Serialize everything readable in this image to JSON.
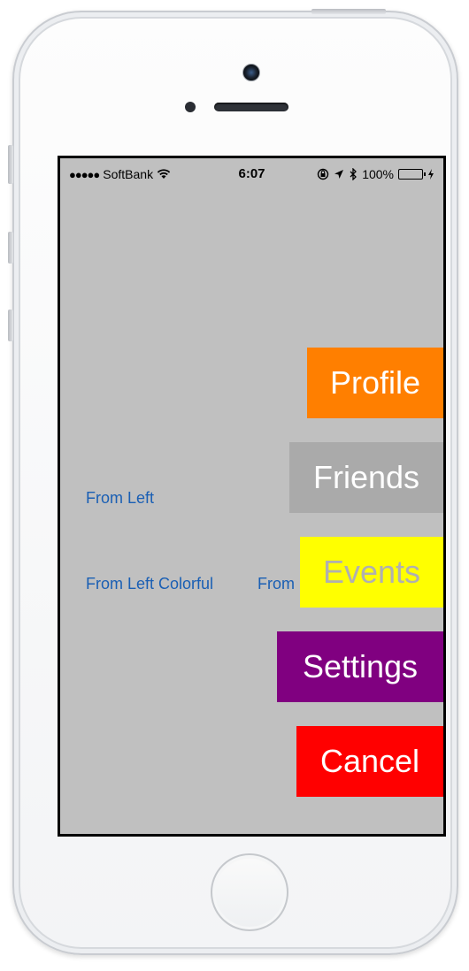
{
  "status_bar": {
    "signal": "●●●●●",
    "carrier": "SoftBank",
    "wifi_icon": "wifi-icon",
    "time": "6:07",
    "battery_percent": "100%",
    "battery_level": 1.0,
    "battery_color": "#4cd964"
  },
  "links": {
    "from_left": "From Left",
    "from_left_colorful": "From Left Colorful",
    "from_partial": "From"
  },
  "menu": {
    "profile": {
      "label": "Profile",
      "color": "#ff7f00"
    },
    "friends": {
      "label": "Friends",
      "color": "#aaaaaa"
    },
    "events": {
      "label": "Events",
      "color": "#ffff00"
    },
    "settings": {
      "label": "Settings",
      "color": "#800080"
    },
    "cancel": {
      "label": "Cancel",
      "color": "#ff0000"
    }
  },
  "colors": {
    "background": "#c0c0c0",
    "link": "#1a5fb4"
  }
}
